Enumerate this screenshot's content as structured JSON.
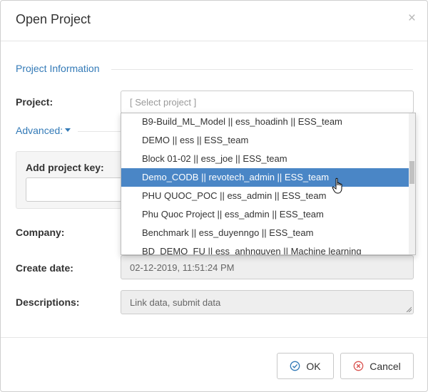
{
  "dialog": {
    "title": "Open Project",
    "close_glyph": "×"
  },
  "section": {
    "title": "Project Information"
  },
  "form": {
    "project_label": "Project:",
    "project_placeholder": "[ Select project ]",
    "advanced_label": "Advanced:",
    "add_project_key_label": "Add project key:",
    "company_label": "Company:",
    "create_date_label": "Create date:",
    "create_date_value": "02-12-2019, 11:51:24 PM",
    "descriptions_label": "Descriptions:",
    "descriptions_value": "Link data, submit data"
  },
  "dropdown": {
    "selected_index": 3,
    "options": [
      "B9-Build_ML_Model || ess_hoadinh || ESS_team",
      "DEMO || ess || ESS_team",
      "Block 01-02 || ess_joe || ESS_team",
      "Demo_CODB || revotech_admin || ESS_team",
      "PHU QUOC_POC || ess_admin || ESS_team",
      "Phu Quoc Project || ess_admin || ESS_team",
      "Benchmark || ess_duyenngo || ESS_team",
      "BD_DEMO_FU || ess_anhnguyen || Machine learning"
    ]
  },
  "buttons": {
    "ok_label": "OK",
    "cancel_label": "Cancel"
  },
  "colors": {
    "accent": "#337ab7",
    "selected_bg": "#4a86c6",
    "cancel_icon": "#d9534f"
  },
  "icons": {
    "ok": "check-circle-icon",
    "cancel": "x-circle-icon",
    "cursor": "hand-pointer-icon"
  }
}
